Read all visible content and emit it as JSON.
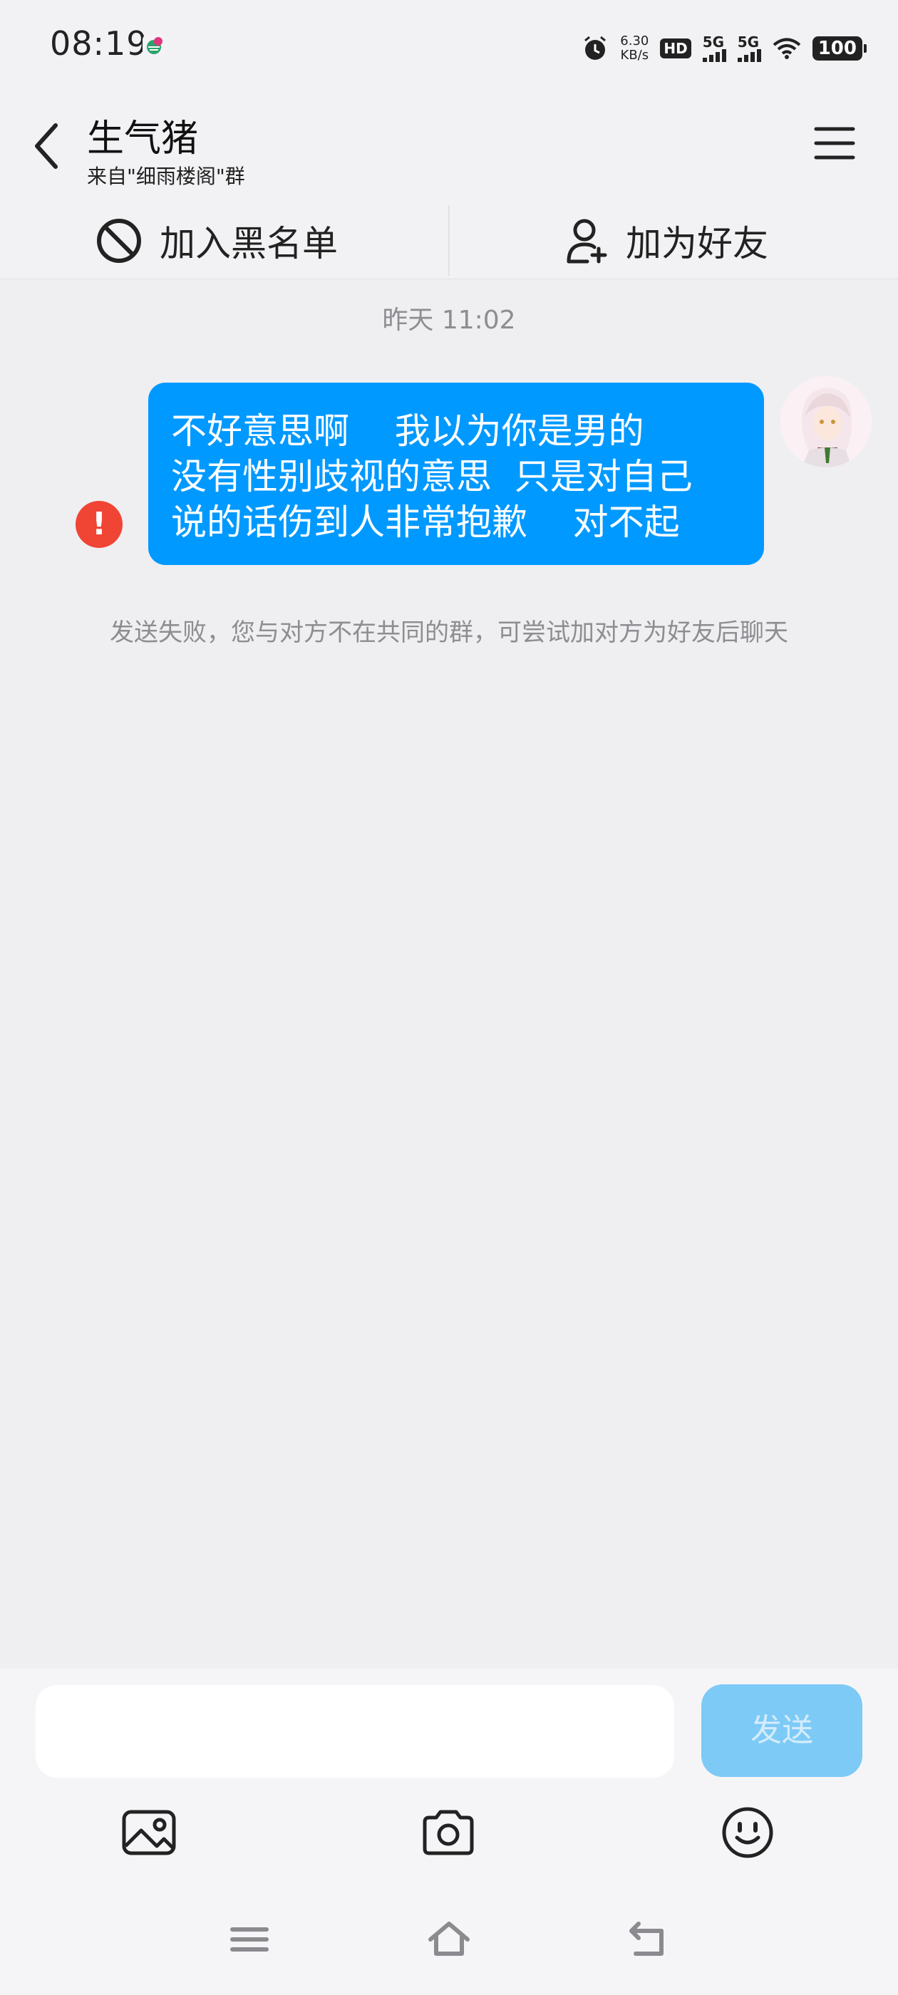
{
  "status_bar": {
    "time": "08:19",
    "net_speed_value": "6.30",
    "net_speed_unit": "KB/s",
    "hd_label": "HD",
    "sim1_label": "5G",
    "sim2_label": "5G",
    "battery": "100"
  },
  "header": {
    "title": "生气猪",
    "subtitle": "来自\"细雨楼阁\"群"
  },
  "actions": {
    "blacklist_label": "加入黑名单",
    "add_friend_label": "加为好友"
  },
  "chat": {
    "timestamp": "昨天  11:02",
    "message_text": "不好意思啊    我以为你是男的\n没有性别歧视的意思  只是对自己\n说的话伤到人非常抱歉    对不起",
    "error_mark": "!",
    "fail_notice": "发送失败，您与对方不在共同的群，可尝试加对方为好友后聊天"
  },
  "composer": {
    "input_value": "",
    "send_label": "发送"
  },
  "colors": {
    "bubble": "#0099ff",
    "send_button": "#7dcaf7",
    "error": "#f04434",
    "background": "#efeff1"
  },
  "icons": {
    "back": "chevron-left-icon",
    "menu": "hamburger-menu-icon",
    "blacklist": "block-icon",
    "add_friend": "add-user-icon",
    "image": "image-icon",
    "camera": "camera-icon",
    "emoji": "emoji-icon",
    "nav_menu": "nav-menu-icon",
    "nav_home": "home-icon",
    "nav_back": "back-icon"
  }
}
